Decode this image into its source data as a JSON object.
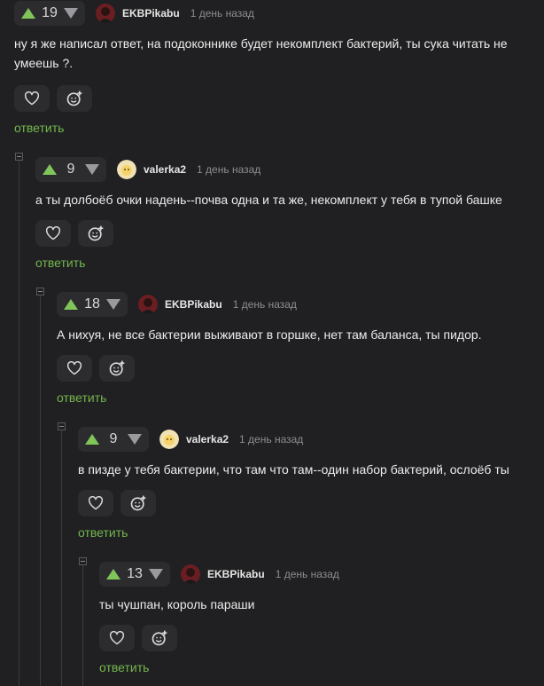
{
  "icons": {
    "upvote": "triangle-up-icon",
    "downvote": "triangle-down-icon",
    "like": "heart-icon",
    "react": "smile-plus-icon",
    "collapse": "minus-square-icon"
  },
  "colors": {
    "background": "#202022",
    "accent_green": "#73b64d",
    "upvote": "#7fc55a",
    "muted": "#8d8d92"
  },
  "comments": [
    {
      "rating": "19",
      "author": "EKBPikabu",
      "time": "1 день назад",
      "text": "ну я же написал ответ, на подоконнике будет некомплект бактерий, ты сука читать не умеешь ?.",
      "reply_label": "ответить"
    },
    {
      "rating": "9",
      "author": "valerka2",
      "time": "1 день назад",
      "text": "а ты долбоёб очки надень--почва одна и та же, некомплект у тебя в тупой башке",
      "reply_label": "ответить"
    },
    {
      "rating": "18",
      "author": "EKBPikabu",
      "time": "1 день назад",
      "text": "А нихуя, не все бактерии выживают в горшке, нет там баланса, ты пидор.",
      "reply_label": "ответить"
    },
    {
      "rating": "9",
      "author": "valerka2",
      "time": "1 день назад",
      "text": "в пизде у тебя бактерии, что там что там--один набор бактерий, ослоёб ты",
      "reply_label": "ответить"
    },
    {
      "rating": "13",
      "author": "EKBPikabu",
      "time": "1 день назад",
      "text": "ты чушпан, король параши",
      "reply_label": "ответить"
    }
  ]
}
